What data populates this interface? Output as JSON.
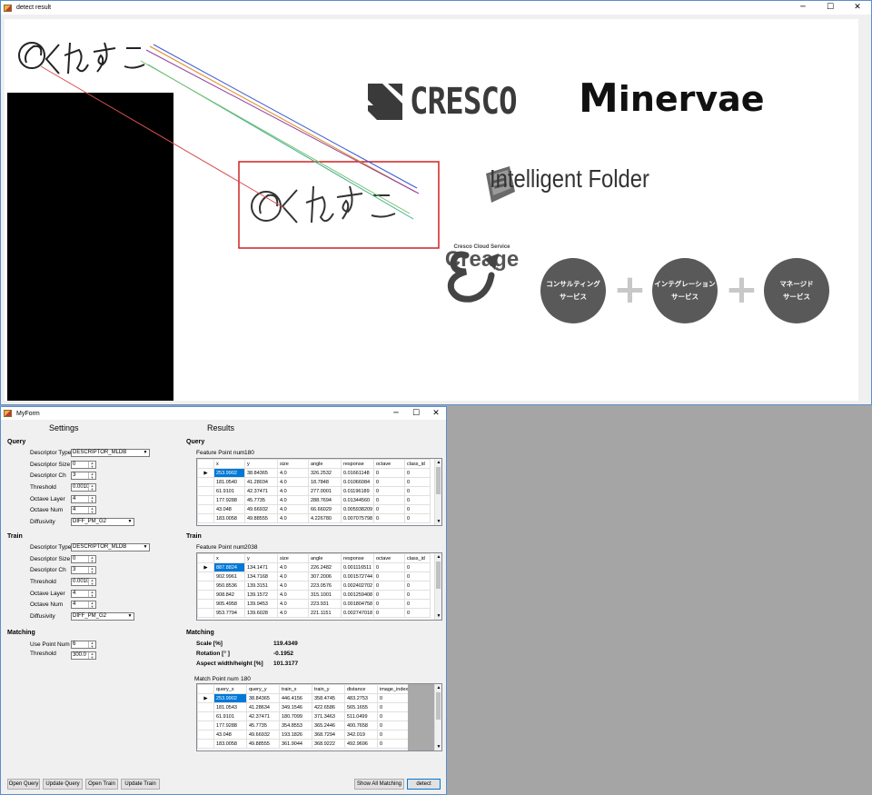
{
  "detect_window": {
    "title": "detect result",
    "controls": {
      "min": "─",
      "max": "☐",
      "close": "✕"
    },
    "logos": {
      "cresco": "CRESCO",
      "minervae_m": "M",
      "minervae_rest": "inervae",
      "intelligent_folder": "Intelligent Folder",
      "creage_sub": "Cresco Cloud Service",
      "creage": "Creage"
    },
    "services": [
      {
        "line1": "コンサルティング",
        "line2": "サービス"
      },
      {
        "line1": "インテグレーション",
        "line2": "サービス"
      },
      {
        "line1": "マネージド",
        "line2": "サービス"
      }
    ],
    "plus": "+"
  },
  "myform": {
    "title": "MyForm",
    "controls": {
      "min": "─",
      "max": "☐",
      "close": "✕"
    },
    "settings_heading": "Settings",
    "results_heading": "Results",
    "query": {
      "heading": "Query",
      "descriptor_type_label": "Descriptor Type",
      "descriptor_type": "DESCRIPTOR_MLDB",
      "descriptor_size_label": "Descriptor Size",
      "descriptor_size": "0",
      "descriptor_ch_label": "Descriptor Ch",
      "descriptor_ch": "3",
      "threshold_label": "Threshold",
      "threshold": "0.0010",
      "octave_layer_label": "Octave Layer",
      "octave_layer": "4",
      "octave_num_label": "Octave Num",
      "octave_num": "4",
      "diffusivity_label": "Diffusivity",
      "diffusivity": "DIFF_PM_G2"
    },
    "train": {
      "heading": "Train",
      "descriptor_type_label": "Descriptor Type",
      "descriptor_type": "DESCRIPTOR_MLDB",
      "descriptor_size_label": "Descriptor Size",
      "descriptor_size": "0",
      "descriptor_ch_label": "Descriptor Ch",
      "descriptor_ch": "3",
      "threshold_label": "Threshold",
      "threshold": "0.0010",
      "octave_layer_label": "Octave Layer",
      "octave_layer": "4",
      "octave_num_label": "Octave Num",
      "octave_num": "4",
      "diffusivity_label": "Diffusivity",
      "diffusivity": "DIFF_PM_G2"
    },
    "matching": {
      "heading": "Matching",
      "use_point_num_label": "Use Point Num",
      "use_point_num": "6",
      "threshold_label": "Threshold",
      "threshold": "300.0"
    },
    "results": {
      "query_heading": "Query",
      "query_fp_label": "Feature Point num",
      "query_fp": "180",
      "query_columns": [
        "x",
        "y",
        "size",
        "angle",
        "response",
        "octave",
        "class_id"
      ],
      "query_rows": [
        [
          "253.9902",
          "38.84365",
          "4.0",
          "326.2532",
          "0.01661148",
          "0",
          "0"
        ],
        [
          "181.0540",
          "41.28034",
          "4.0",
          "18.7848",
          "0.01066084",
          "0",
          "0"
        ],
        [
          "61.9101",
          "42.37471",
          "4.0",
          "277.0001",
          "0.01196189",
          "0",
          "0"
        ],
        [
          "177.9288",
          "45.7735",
          "4.0",
          "288.7694",
          "0.01344560",
          "0",
          "0"
        ],
        [
          "43.048",
          "49.66932",
          "4.0",
          "66.66029",
          "0.005938209",
          "0",
          "0"
        ],
        [
          "183.0058",
          "49.88555",
          "4.0",
          "4.226780",
          "0.007075798",
          "0",
          "0"
        ]
      ],
      "train_heading": "Train",
      "train_fp_label": "Feature Point num",
      "train_fp": "2038",
      "train_columns": [
        "x",
        "y",
        "size",
        "angle",
        "response",
        "octave",
        "class_id"
      ],
      "train_rows": [
        [
          "887.8824",
          "134.1471",
          "4.0",
          "226.2482",
          "0.001116511",
          "0",
          "0"
        ],
        [
          "902.9961",
          "134.7168",
          "4.0",
          "307.2006",
          "0.001572744",
          "0",
          "0"
        ],
        [
          "950.8536",
          "139.3151",
          "4.0",
          "223.0576",
          "0.002402702",
          "0",
          "0"
        ],
        [
          "908.842",
          "139.1572",
          "4.0",
          "315.1001",
          "0.001259408",
          "0",
          "0"
        ],
        [
          "905.4958",
          "139.9453",
          "4.0",
          "223.931",
          "0.001804758",
          "0",
          "0"
        ],
        [
          "953.7794",
          "139.6028",
          "4.0",
          "221.1151",
          "0.002747018",
          "0",
          "0"
        ]
      ],
      "matching_heading": "Matching",
      "scale_label": "Scale [%]",
      "scale": "119.4349",
      "rotation_label": "Rotation [° ]",
      "rotation": "-0.1952",
      "aspect_label": "Aspect width/height [%]",
      "aspect": "101.3177",
      "match_label": "Match Point num",
      "match_num": "180",
      "match_columns": [
        "query_x",
        "query_y",
        "train_x",
        "train_y",
        "distance",
        "image_index"
      ],
      "match_rows": [
        [
          "253.9902",
          "38.84365",
          "446.4156",
          "358.4745",
          "483.2753",
          "0"
        ],
        [
          "181.0543",
          "41.28634",
          "349.1546",
          "422.6586",
          "565.1655",
          "0"
        ],
        [
          "61.9101",
          "42.37471",
          "180.7099",
          "371.3463",
          "511.0499",
          "0"
        ],
        [
          "177.9288",
          "45.7735",
          "354.8553",
          "365.2446",
          "400.7658",
          "0"
        ],
        [
          "43.048",
          "49.66932",
          "193.1826",
          "368.7294",
          "342.019",
          "0"
        ],
        [
          "183.0058",
          "49.88555",
          "361.9044",
          "368.9222",
          "492.9696",
          "0"
        ]
      ]
    },
    "buttons": {
      "open_query": "Open Query",
      "update_query": "Update Query",
      "open_train": "Open Train",
      "update_train": "Update Train",
      "show_all": "Show All Matching",
      "detect": "detect"
    }
  }
}
